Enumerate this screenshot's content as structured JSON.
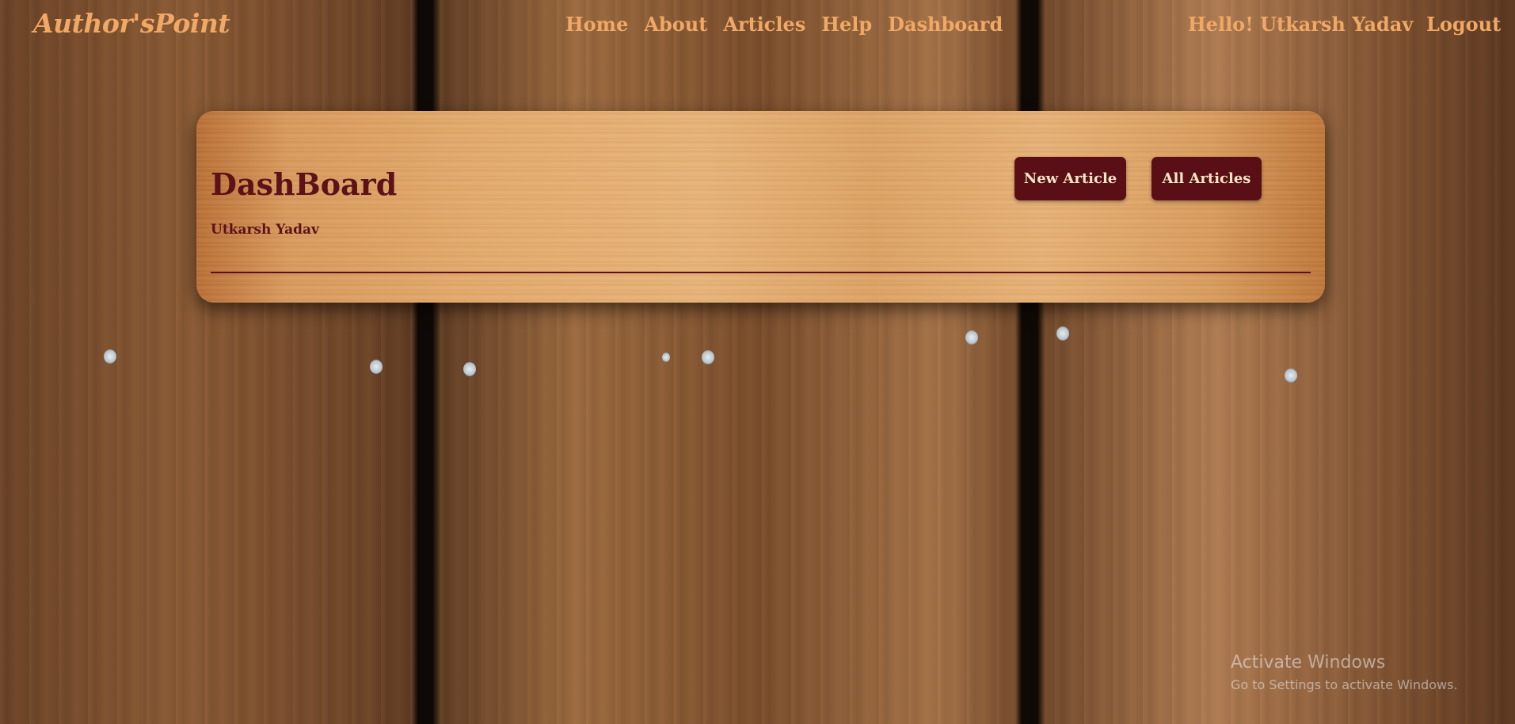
{
  "header": {
    "logo": "Author'sPoint",
    "nav": [
      "Home",
      "About",
      "Articles",
      "Help",
      "Dashboard"
    ],
    "greeting": "Hello! Utkarsh Yadav",
    "logout_label": "Logout"
  },
  "dashboard": {
    "title": "DashBoard",
    "user_name": "Utkarsh Yadav",
    "new_article_label": "New Article",
    "all_articles_label": "All Articles"
  },
  "watermark": {
    "title": "Activate Windows",
    "subtitle": "Go to Settings to activate Windows."
  },
  "colors": {
    "nav_text": "#f0a865",
    "accent_dark": "#5a0f17",
    "button_text": "#f6e6c4"
  }
}
